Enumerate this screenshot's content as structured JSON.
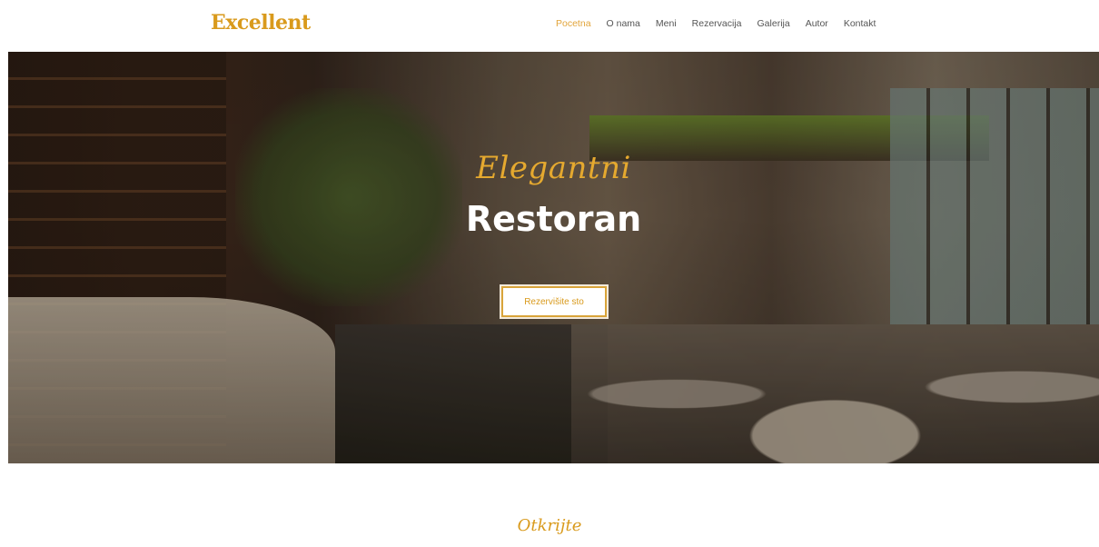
{
  "header": {
    "logo": "Excellent",
    "nav": [
      {
        "label": "Pocetna",
        "active": true
      },
      {
        "label": "O nama"
      },
      {
        "label": "Meni"
      },
      {
        "label": "Rezervacija"
      },
      {
        "label": "Galerija"
      },
      {
        "label": "Autor"
      },
      {
        "label": "Kontakt"
      }
    ]
  },
  "hero": {
    "subtitle": "Elegantni",
    "title": "Restoran",
    "button_label": "Rezervišite sto"
  },
  "section": {
    "subtitle": "Otkrijte"
  },
  "colors": {
    "accent": "#d99a1c",
    "nav_text": "#555555",
    "white": "#ffffff"
  }
}
